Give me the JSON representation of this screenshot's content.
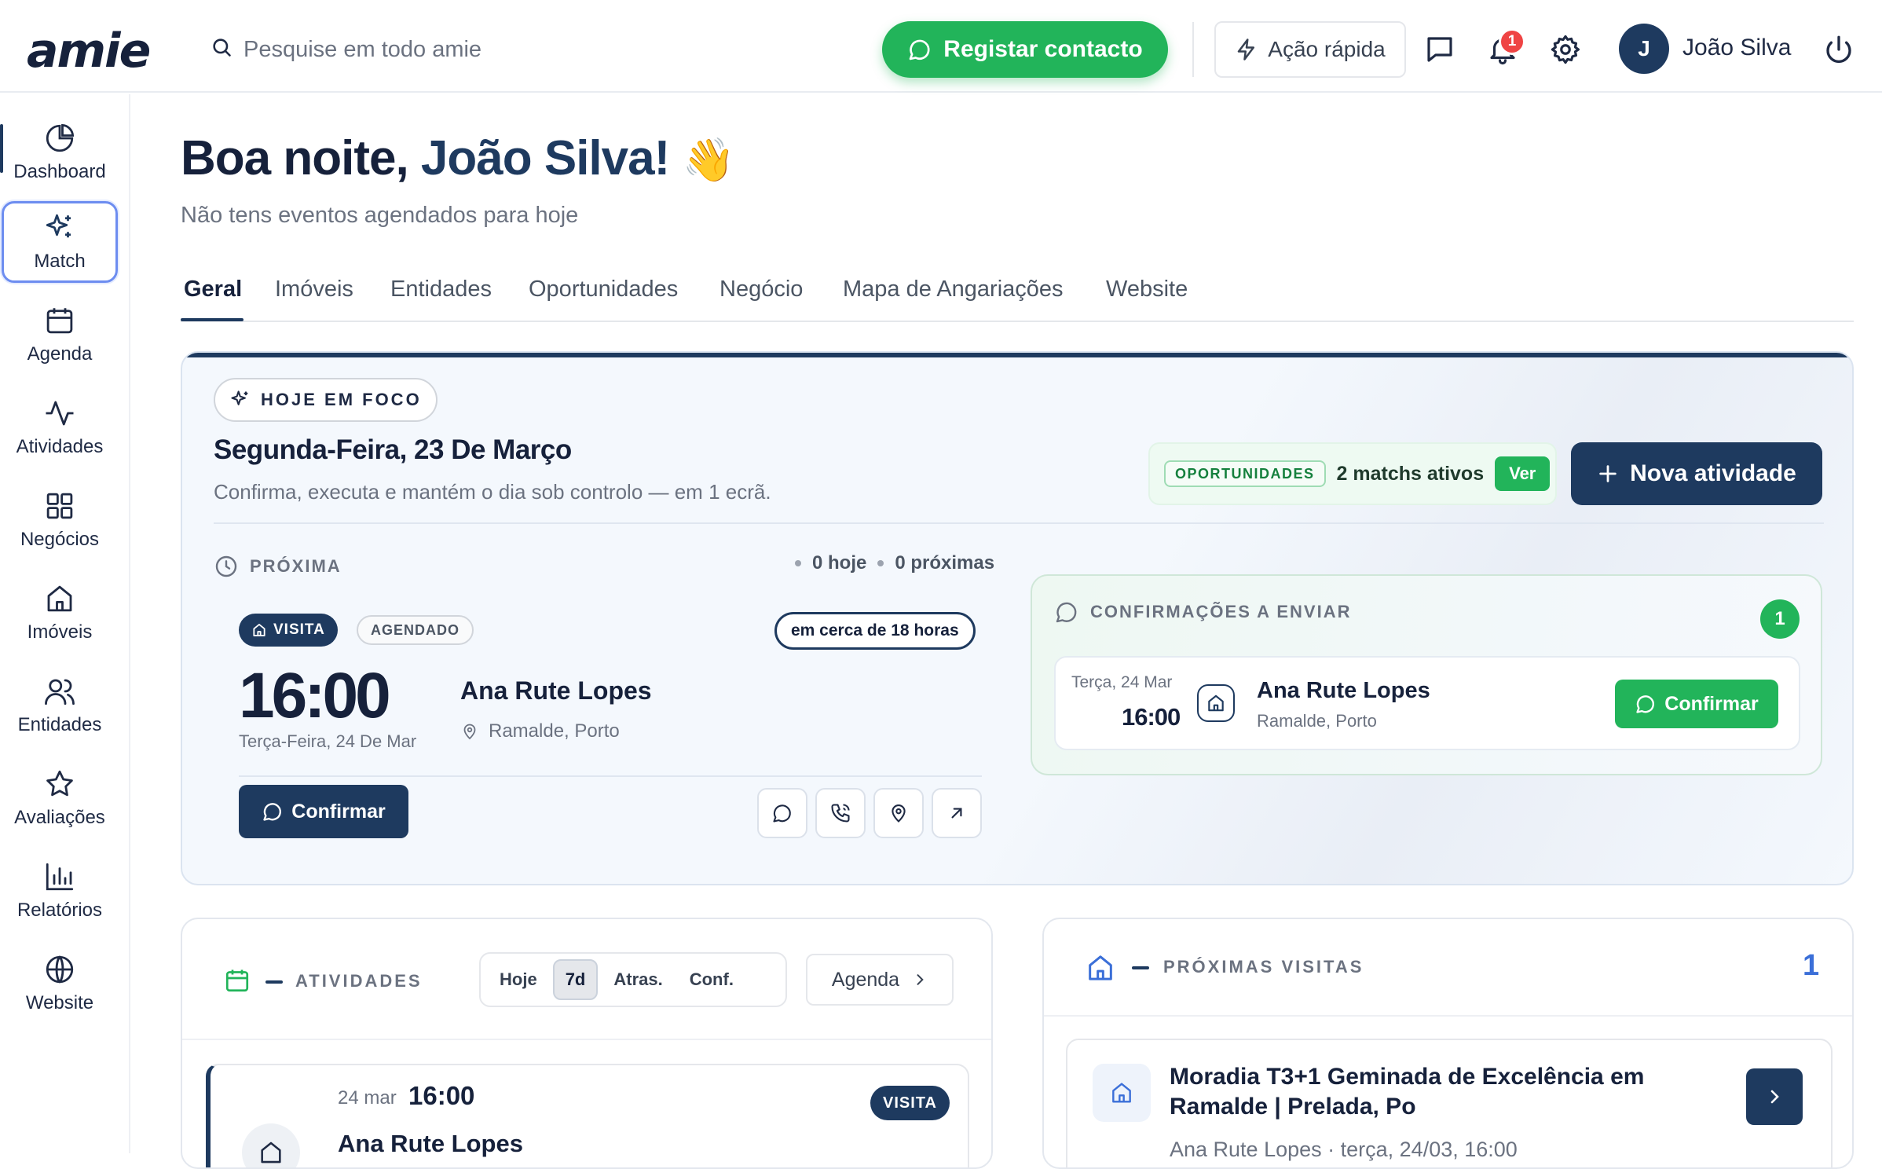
{
  "header": {
    "logo": "amie",
    "search_placeholder": "Pesquise em todo amie",
    "register_label": "Registar contacto",
    "quick_action_label": "Ação rápida",
    "notifications_count": "1",
    "avatar_initial": "J",
    "user_name": "João Silva"
  },
  "sidebar": {
    "items": [
      {
        "label": "Dashboard",
        "icon": "pie-chart-icon"
      },
      {
        "label": "Match",
        "icon": "sparkles-icon"
      },
      {
        "label": "Agenda",
        "icon": "calendar-icon"
      },
      {
        "label": "Atividades",
        "icon": "activity-icon"
      },
      {
        "label": "Negócios",
        "icon": "grid-icon"
      },
      {
        "label": "Imóveis",
        "icon": "home-icon"
      },
      {
        "label": "Entidades",
        "icon": "users-icon"
      },
      {
        "label": "Avaliações",
        "icon": "star-icon"
      },
      {
        "label": "Relatórios",
        "icon": "bar-chart-icon"
      },
      {
        "label": "Website",
        "icon": "globe-icon"
      }
    ]
  },
  "greeting": {
    "prefix": "Boa noite, ",
    "name": "João Silva!",
    "emoji": "👋",
    "subtitle": "Não tens eventos agendados para hoje"
  },
  "tabs": [
    "Geral",
    "Imóveis",
    "Entidades",
    "Oportunidades",
    "Negócio",
    "Mapa de Angariações",
    "Website"
  ],
  "focus": {
    "pill_label": "HOJE EM FOCO",
    "date": "Segunda-Feira, 23 De Março",
    "description": "Confirma, executa e mantém o dia sob controlo — em 1 ecrã.",
    "opps_tag": "OPORTUNIDADES",
    "opps_count": "2 matchs ativos",
    "opps_action": "Ver",
    "new_activity_label": "Nova atividade",
    "next_label": "PRÓXIMA",
    "today_count": "0 hoje",
    "upcoming_count": "0 próximas",
    "event": {
      "type": "VISITA",
      "status": "AGENDADO",
      "eta": "em cerca de 18 horas",
      "time": "16:00",
      "date": "Terça-Feira, 24 De Mar",
      "name": "Ana Rute Lopes",
      "location": "Ramalde, Porto",
      "confirm_label": "Confirmar"
    },
    "confirmations": {
      "title": "CONFIRMAÇÕES A ENVIAR",
      "count": "1",
      "date": "Terça, 24 Mar",
      "time": "16:00",
      "name": "Ana Rute Lopes",
      "location": "Ramalde, Porto",
      "confirm_label": "Confirmar"
    }
  },
  "activities": {
    "title": "ATIVIDADES",
    "filters": [
      "Hoje",
      "7d",
      "Atras.",
      "Conf."
    ],
    "active_filter": "7d",
    "agenda_label": "Agenda",
    "item": {
      "date": "24 mar",
      "time": "16:00",
      "name": "Ana Rute Lopes",
      "tag": "VISITA"
    }
  },
  "visits": {
    "title": "PRÓXIMAS VISITAS",
    "count": "1",
    "item": {
      "title": "Moradia T3+1 Geminada de Excelência em Ramalde | Prelada, Po",
      "subtitle": "Ana Rute Lopes · terça, 24/03, 16:00"
    }
  },
  "colors": {
    "primary": "#1e3a5f",
    "accent_green": "#22b45a",
    "badge_red": "#ef4444",
    "link_blue": "#3b6fd8"
  }
}
